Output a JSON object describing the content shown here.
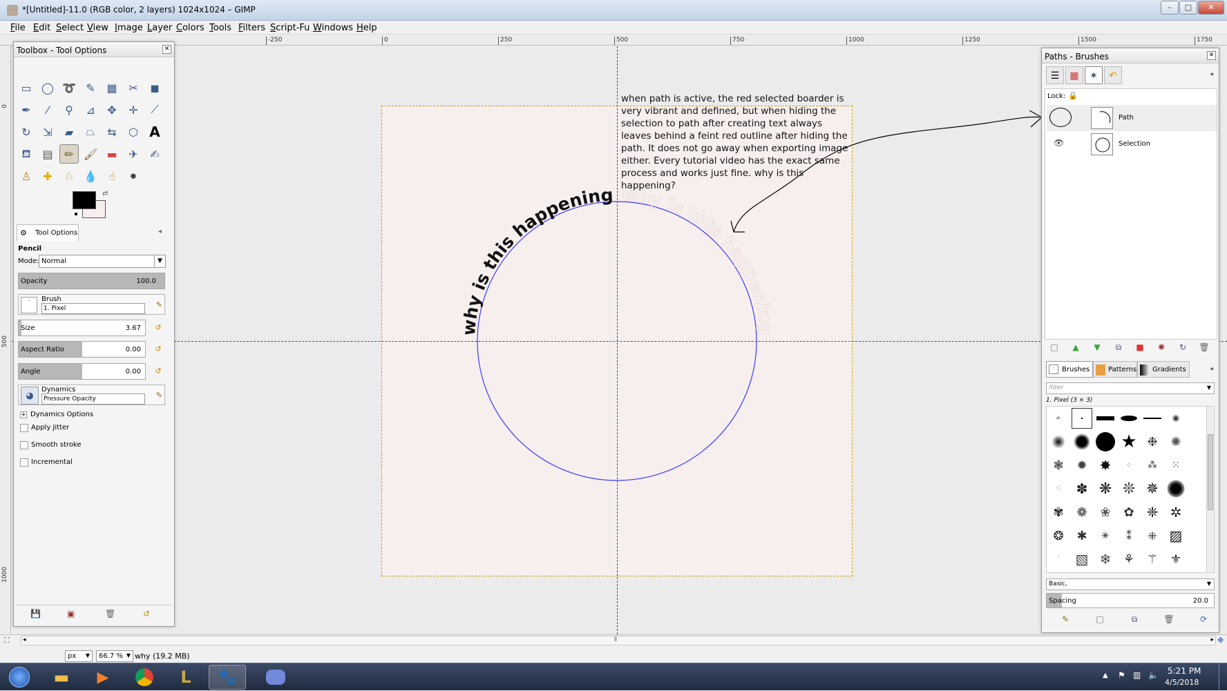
{
  "window": {
    "title": "*[Untitled]-11.0 (RGB color, 2 layers) 1024x1024 – GIMP",
    "minimize": "–",
    "maximize": "□",
    "close": "✕"
  },
  "menu": [
    "File",
    "Edit",
    "Select",
    "View",
    "Image",
    "Layer",
    "Colors",
    "Tools",
    "Filters",
    "Script-Fu",
    "Windows",
    "Help"
  ],
  "ruler": {
    "h_ticks": [
      "-250",
      "0",
      "250",
      "500",
      "750",
      "1000",
      "1250",
      "1500",
      "1750"
    ],
    "v_ticks": [
      "0",
      "500",
      "1000"
    ]
  },
  "toolbox": {
    "title": "Toolbox - Tool Options",
    "tool_options_tab": "Tool Options",
    "tool_name": "Pencil",
    "mode_label": "Mode:",
    "mode_value": "Normal",
    "opacity_label": "Opacity",
    "opacity_value": "100.0",
    "brush_label": "Brush",
    "brush_value": "1. Pixel",
    "size_label": "Size",
    "size_value": "3.67",
    "aspect_label": "Aspect Ratio",
    "aspect_value": "0.00",
    "angle_label": "Angle",
    "angle_value": "0.00",
    "dynamics_label": "Dynamics",
    "dynamics_value": "Pressure Opacity",
    "dynamics_options": "Dynamics Options",
    "apply_jitter": "Apply Jitter",
    "smooth_stroke": "Smooth stroke",
    "incremental": "Incremental"
  },
  "canvas": {
    "curved_text": "why is this happening",
    "ghost_text": "why is this happening",
    "annotation": "when path is active, the red selected boarder is very vibrant and defined, but when hiding the selection to path after creating text always leaves behind a feint red outline after hiding the path. It does not go away when exporting image either. Every tutorial video has the exact same process and works just fine. why is this happening?"
  },
  "paths_dock": {
    "title": "Paths - Brushes",
    "lock_label": "Lock:",
    "paths": [
      {
        "name": "Path",
        "visible": false
      },
      {
        "name": "Selection",
        "visible": true
      }
    ],
    "tabs": [
      "Brushes",
      "Patterns",
      "Gradients"
    ],
    "filter_placeholder": "filter",
    "brush_selected": "1. Pixel (3 × 3)",
    "preset": "Basic,",
    "spacing_label": "Spacing",
    "spacing_value": "20.0"
  },
  "status": {
    "unit": "px",
    "zoom": "66.7 %",
    "message": "why (19.2 MB)"
  },
  "taskbar": {
    "time": "5:21 PM",
    "date": "4/5/2018"
  }
}
